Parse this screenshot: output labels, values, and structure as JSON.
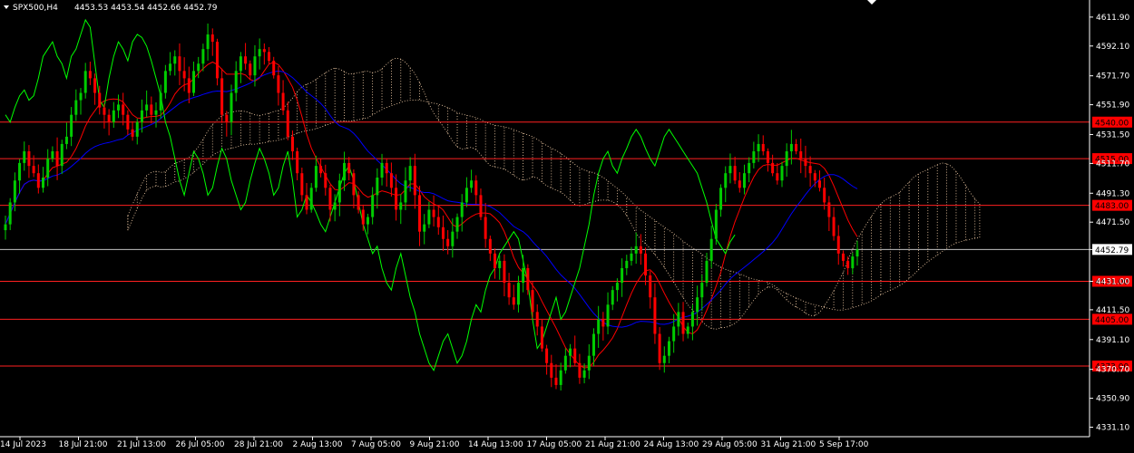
{
  "header": {
    "symbol_timeframe": "SPX500,H4",
    "ohlc": "4453.53 4453.54 4452.66 4452.79"
  },
  "chart_data": {
    "type": "candlestick",
    "price_scale": {
      "ylim": [
        4324.6,
        4623.6
      ],
      "tick_labels": [
        "4611.90",
        "4592.10",
        "4571.70",
        "4551.90",
        "4531.50",
        "4511.70",
        "4491.30",
        "4471.50",
        "4452.79",
        "4431.00",
        "4411.50",
        "4391.10",
        "4370.70",
        "4350.90",
        "4331.10"
      ],
      "tick_values": [
        4611.9,
        4592.1,
        4571.7,
        4551.9,
        4531.5,
        4511.7,
        4491.3,
        4471.5,
        4452.79,
        4431.0,
        4411.5,
        4391.1,
        4370.7,
        4350.9,
        4331.1
      ]
    },
    "time_axis": {
      "labels": [
        "14 Jul 2023",
        "18 Jul 21:00",
        "21 Jul 13:00",
        "26 Jul 05:00",
        "28 Jul 21:00",
        "2 Aug 13:00",
        "7 Aug 05:00",
        "9 Aug 21:00",
        "14 Aug 13:00",
        "17 Aug 05:00",
        "21 Aug 21:00",
        "24 Aug 13:00",
        "29 Aug 05:00",
        "31 Aug 21:00",
        "5 Sep 17:00"
      ]
    },
    "horizontal_levels": [
      {
        "label": "4540.00",
        "value": 4540.0
      },
      {
        "label": "4515.00",
        "value": 4515.0
      },
      {
        "label": "4483.00",
        "value": 4483.0
      },
      {
        "label": "4431.00",
        "value": 4431.0
      },
      {
        "label": "4405.00",
        "value": 4405.0
      },
      {
        "label": "4373.00",
        "value": 4373.0
      }
    ],
    "current_price": {
      "label": "4452.79",
      "value": 4452.79
    },
    "candles_close_approx": [
      4470,
      4485,
      4500,
      4512,
      4520,
      4510,
      4505,
      4495,
      4502,
      4515,
      4520,
      4510,
      4525,
      4530,
      4545,
      4555,
      4560,
      4575,
      4570,
      4560,
      4550,
      4545,
      4540,
      4548,
      4552,
      4545,
      4535,
      4530,
      4540,
      4548,
      4552,
      4545,
      4548,
      4560,
      4575,
      4580,
      4585,
      4575,
      4570,
      4560,
      4575,
      4580,
      4590,
      4600,
      4595,
      4570,
      4545,
      4540,
      4560,
      4575,
      4585,
      4580,
      4572,
      4585,
      4590,
      4588,
      4582,
      4572,
      4560,
      4548,
      4530,
      4520,
      4505,
      4490,
      4480,
      4495,
      4510,
      4505,
      4495,
      4480,
      4485,
      4500,
      4512,
      4505,
      4490,
      4480,
      4470,
      4475,
      4490,
      4502,
      4512,
      4505,
      4495,
      4480,
      4485,
      4500,
      4510,
      4490,
      4465,
      4470,
      4480,
      4475,
      4468,
      4460,
      4455,
      4465,
      4475,
      4485,
      4495,
      4500,
      4490,
      4475,
      4460,
      4450,
      4440,
      4445,
      4430,
      4420,
      4415,
      4430,
      4440,
      4425,
      4410,
      4400,
      4385,
      4375,
      4365,
      4360,
      4370,
      4380,
      4385,
      4375,
      4365,
      4370,
      4380,
      4395,
      4405,
      4400,
      4415,
      4425,
      4430,
      4440,
      4445,
      4450,
      4455,
      4450,
      4435,
      4420,
      4395,
      4375,
      4380,
      4390,
      4400,
      4410,
      4395,
      4400,
      4410,
      4420,
      4430,
      4445,
      4460,
      4480,
      4495,
      4505,
      4510,
      4500,
      4495,
      4505,
      4512,
      4520,
      4525,
      4520,
      4512,
      4505,
      4500,
      4510,
      4520,
      4525,
      4520,
      4515,
      4510,
      4505,
      4500,
      4495,
      4485,
      4475,
      4462,
      4450,
      4445,
      4440,
      4448,
      4452.79
    ],
    "series": [
      {
        "name": "",
        "color": "#ff0000"
      },
      {
        "name": "",
        "color": "#0000ff"
      },
      {
        "name": "",
        "color": "#00ff00"
      }
    ]
  }
}
